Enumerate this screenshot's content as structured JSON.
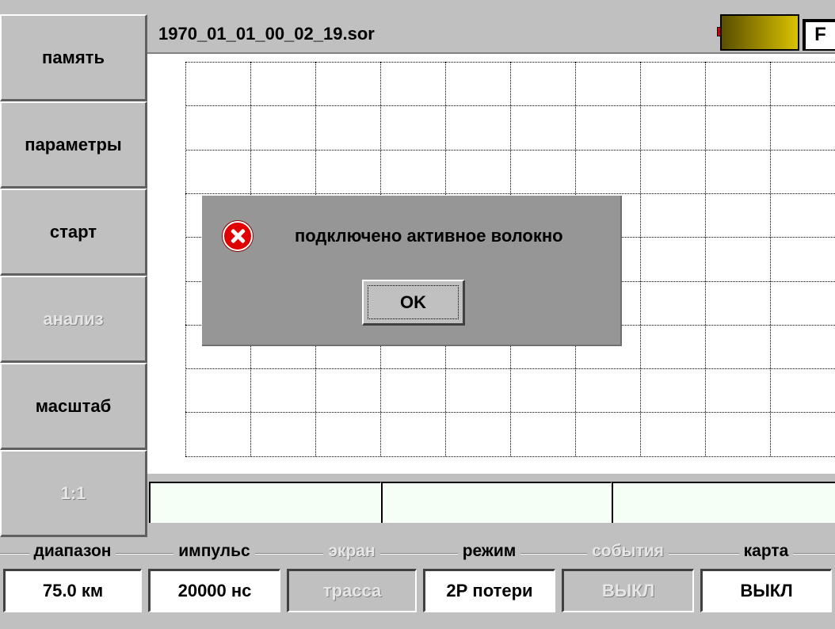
{
  "menu": [
    {
      "label": "память",
      "enabled": true
    },
    {
      "label": "параметры",
      "enabled": true
    },
    {
      "label": "старт",
      "enabled": true
    },
    {
      "label": "анализ",
      "enabled": false
    },
    {
      "label": "масштаб",
      "enabled": true
    },
    {
      "label": "1:1",
      "enabled": false
    }
  ],
  "header": {
    "filename": "1970_01_01_00_02_19.sor",
    "mode_indicator": "F"
  },
  "dialog": {
    "message": "подключено активное волокно",
    "ok_label": "OK",
    "icon": "error-icon"
  },
  "settings": [
    {
      "label": "диапазон",
      "value": "75.0 км",
      "enabled": true
    },
    {
      "label": "импульс",
      "value": "20000 нс",
      "enabled": true
    },
    {
      "label": "экран",
      "value": "трасса",
      "enabled": false
    },
    {
      "label": "режим",
      "value": "2Р потери",
      "enabled": true
    },
    {
      "label": "события",
      "value": "ВЫКЛ",
      "enabled": false
    },
    {
      "label": "карта",
      "value": "ВЫКЛ",
      "enabled": true
    }
  ],
  "colors": {
    "background": "#c0c0c0",
    "dialog": "#969696",
    "error_red": "#e00000"
  }
}
